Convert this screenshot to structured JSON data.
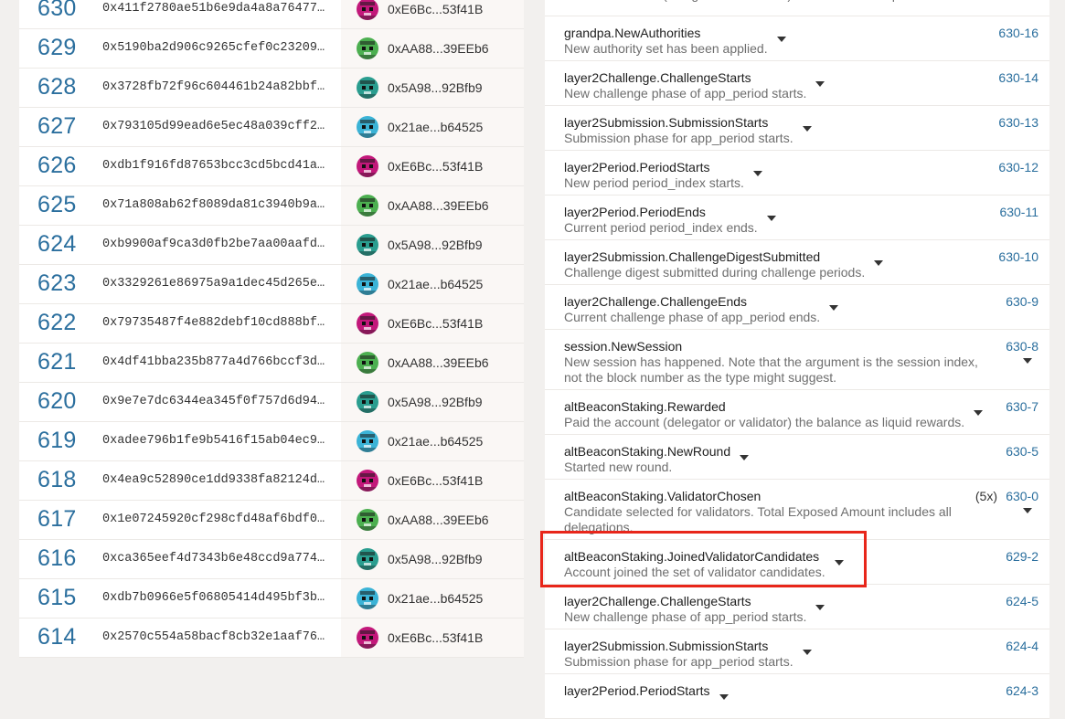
{
  "blocks": [
    {
      "number": "630",
      "hash": "0x411f2780ae51b6e9da4a8a764778a...",
      "author": "0xE6Bc...53f41B",
      "avatar": "magenta-robot-icon"
    },
    {
      "number": "629",
      "hash": "0x5190ba2d906c9265cfef0c23209ae...",
      "author": "0xAA88...39EEb6",
      "avatar": "green-robot-icon"
    },
    {
      "number": "628",
      "hash": "0x3728fb72f96c604461b24a82bbf01...",
      "author": "0x5A98...92Bfb9",
      "avatar": "teal-robot-icon"
    },
    {
      "number": "627",
      "hash": "0x793105d99ead6e5ec48a039cff2a1...",
      "author": "0x21ae...b64525",
      "avatar": "cyan-robot-icon"
    },
    {
      "number": "626",
      "hash": "0xdb1f916fd87653bcc3cd5bcd41af9...",
      "author": "0xE6Bc...53f41B",
      "avatar": "magenta-robot-icon"
    },
    {
      "number": "625",
      "hash": "0x71a808ab62f8089da81c3940b9a41...",
      "author": "0xAA88...39EEb6",
      "avatar": "green-robot-icon"
    },
    {
      "number": "624",
      "hash": "0xb9900af9ca3d0fb2be7aa00aafd25...",
      "author": "0x5A98...92Bfb9",
      "avatar": "teal-robot-icon"
    },
    {
      "number": "623",
      "hash": "0x3329261e86975a9a1dec45d265e0e...",
      "author": "0x21ae...b64525",
      "avatar": "cyan-robot-icon"
    },
    {
      "number": "622",
      "hash": "0x79735487f4e882debf10cd888bfb6...",
      "author": "0xE6Bc...53f41B",
      "avatar": "magenta-robot-icon"
    },
    {
      "number": "621",
      "hash": "0x4df41bba235b877a4d766bccf3d88...",
      "author": "0xAA88...39EEb6",
      "avatar": "green-robot-icon"
    },
    {
      "number": "620",
      "hash": "0x9e7e7dc6344ea345f0f757d6d94fd...",
      "author": "0x5A98...92Bfb9",
      "avatar": "teal-robot-icon"
    },
    {
      "number": "619",
      "hash": "0xadee796b1fe9b5416f15ab04ec925...",
      "author": "0x21ae...b64525",
      "avatar": "cyan-robot-icon"
    },
    {
      "number": "618",
      "hash": "0x4ea9c52890ce1dd9338fa82124d20...",
      "author": "0xE6Bc...53f41B",
      "avatar": "magenta-robot-icon"
    },
    {
      "number": "617",
      "hash": "0x1e07245920cf298cfd48af6bdf09a...",
      "author": "0xAA88...39EEb6",
      "avatar": "green-robot-icon"
    },
    {
      "number": "616",
      "hash": "0xca365eef4d7343b6e48ccd9a774f3...",
      "author": "0x5A98...92Bfb9",
      "avatar": "teal-robot-icon"
    },
    {
      "number": "615",
      "hash": "0xdb7b0966e5f06805414d495bf3b1f...",
      "author": "0x21ae...b64525",
      "avatar": "cyan-robot-icon"
    },
    {
      "number": "614",
      "hash": "0x2570c554a58bacf8cb32e1aaf7658...",
      "author": "0xE6Bc...53f41B",
      "avatar": "magenta-robot-icon"
    }
  ],
  "events": [
    {
      "name": "",
      "desc": "Paid the account (delegator or validator) the balance as liquid rewards.",
      "id": "",
      "count": ""
    },
    {
      "name": "grandpa.NewAuthorities",
      "desc": "New authority set has been applied.",
      "id": "630-16",
      "count": ""
    },
    {
      "name": "layer2Challenge.ChallengeStarts",
      "desc": "New challenge phase of app_period starts.",
      "id": "630-14",
      "count": ""
    },
    {
      "name": "layer2Submission.SubmissionStarts",
      "desc": "Submission phase for app_period starts.",
      "id": "630-13",
      "count": ""
    },
    {
      "name": "layer2Period.PeriodStarts",
      "desc": "New period period_index starts.",
      "id": "630-12",
      "count": ""
    },
    {
      "name": "layer2Period.PeriodEnds",
      "desc": "Current period period_index ends.",
      "id": "630-11",
      "count": ""
    },
    {
      "name": "layer2Submission.ChallengeDigestSubmitted",
      "desc": "Challenge digest submitted during challenge periods.",
      "id": "630-10",
      "count": ""
    },
    {
      "name": "layer2Challenge.ChallengeEnds",
      "desc": "Current challenge phase of app_period ends.",
      "id": "630-9",
      "count": ""
    },
    {
      "name": "session.NewSession",
      "desc": "New session has happened. Note that the argument is the session index, not the block number as the type might suggest.",
      "id": "630-8",
      "count": ""
    },
    {
      "name": "altBeaconStaking.Rewarded",
      "desc": "Paid the account (delegator or validator) the balance as liquid rewards.",
      "id": "630-7",
      "count": ""
    },
    {
      "name": "altBeaconStaking.NewRound",
      "desc": "Started new round.",
      "id": "630-5",
      "count": ""
    },
    {
      "name": "altBeaconStaking.ValidatorChosen",
      "desc": "Candidate selected for validators. Total Exposed Amount includes all delegations.",
      "id": "630-0",
      "count": "(5x)"
    },
    {
      "name": "altBeaconStaking.JoinedValidatorCandidates",
      "desc": "Account joined the set of validator candidates.",
      "id": "629-2",
      "count": ""
    },
    {
      "name": "layer2Challenge.ChallengeStarts",
      "desc": "New challenge phase of app_period starts.",
      "id": "624-5",
      "count": ""
    },
    {
      "name": "layer2Submission.SubmissionStarts",
      "desc": "Submission phase for app_period starts.",
      "id": "624-4",
      "count": ""
    },
    {
      "name": "layer2Period.PeriodStarts",
      "desc": "",
      "id": "624-3",
      "count": ""
    }
  ],
  "colors": {
    "accent": "#2b6f9e",
    "highlight": "#e8261a",
    "avatar_magenta": "#c2187a",
    "avatar_green": "#4caf50",
    "avatar_teal": "#2a9d8f",
    "avatar_cyan": "#3bb3d6"
  }
}
